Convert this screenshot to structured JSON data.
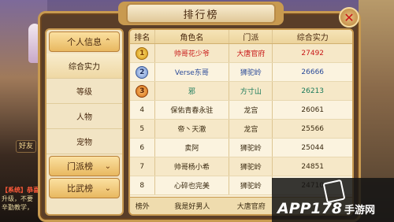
{
  "panel": {
    "title": "排行榜",
    "close_label": "✕"
  },
  "sidebar": {
    "personal": {
      "label": "个人信息",
      "chevron": "⌃"
    },
    "items": [
      {
        "label": "综合实力",
        "active": true
      },
      {
        "label": "等级"
      },
      {
        "label": "人物"
      },
      {
        "label": "宠物"
      }
    ],
    "sect": {
      "label": "门派榜",
      "chevron": "⌄"
    },
    "arena": {
      "label": "比武榜",
      "chevron": "⌄"
    }
  },
  "table": {
    "headers": [
      "排名",
      "角色名",
      "门派",
      "综合实力"
    ],
    "rows": [
      {
        "rank": "1",
        "name": "帅哥花少爷",
        "sect": "大唐官府",
        "power": "27492",
        "color": "#c81818"
      },
      {
        "rank": "2",
        "name": "Verse东哥",
        "sect": "狮驼岭",
        "power": "26666",
        "color": "#2a4a98"
      },
      {
        "rank": "3",
        "name": "邪",
        "sect": "方寸山",
        "power": "26213",
        "color": "#1a7a5a"
      },
      {
        "rank": "4",
        "name": "保佑青春永驻",
        "sect": "龙宫",
        "power": "26061",
        "color": "#3a2a10"
      },
      {
        "rank": "5",
        "name": "帝丶天澈",
        "sect": "龙宫",
        "power": "25566",
        "color": "#3a2a10"
      },
      {
        "rank": "6",
        "name": "卖阿",
        "sect": "狮驼岭",
        "power": "25044",
        "color": "#3a2a10"
      },
      {
        "rank": "7",
        "name": "帅哥杨小希",
        "sect": "狮驼岭",
        "power": "24851",
        "color": "#3a2a10"
      },
      {
        "rank": "8",
        "name": "心碎也完美",
        "sect": "狮驼岭",
        "power": "24710",
        "color": "#3a2a10"
      }
    ],
    "footer": {
      "rank": "榜外",
      "name": "我是好男人",
      "sect": "大唐官府",
      "power": ""
    }
  },
  "background": {
    "tag": "好友",
    "chat_lines": [
      "【系统】恭喜",
      "升级，不要",
      "辛勤教学，"
    ]
  },
  "watermark": {
    "brand": "APP178",
    "site": "手游网"
  }
}
